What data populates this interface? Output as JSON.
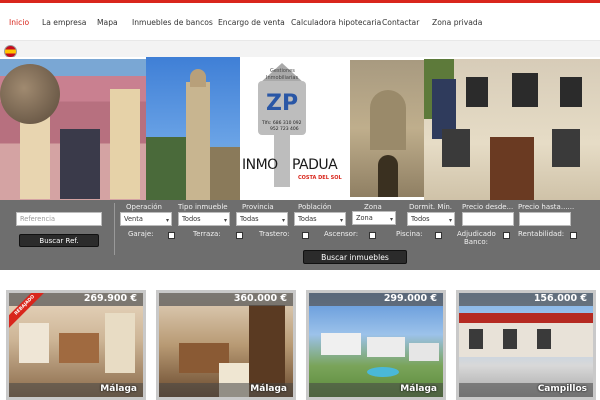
{
  "nav": {
    "items": [
      {
        "label": "Inicio",
        "active": true
      },
      {
        "label": "La empresa",
        "active": false
      },
      {
        "label": "Mapa",
        "active": false
      },
      {
        "label": "Inmuebles de bancos",
        "active": false
      },
      {
        "label": "Encargo de venta",
        "active": false
      },
      {
        "label": "Calculadora hipotecaria",
        "active": false
      },
      {
        "label": "Contactar",
        "active": false
      },
      {
        "label": "Zona privada",
        "active": false
      }
    ]
  },
  "language": {
    "icon": "spain-flag-icon"
  },
  "banner": {
    "logo": {
      "brand_line1": "Gestiones",
      "brand_line2": "Inmobiliarias",
      "initials": "ZP",
      "phone1": "Tlfs: 686 310 092",
      "phone2": "952 723 406",
      "name_left": "INMO",
      "name_right": "PADUA",
      "region": "COSTA DEL SOL"
    }
  },
  "search": {
    "reference_placeholder": "Referencia",
    "reference_button": "Buscar Ref.",
    "fields": [
      {
        "label": "Operación",
        "value": "Venta"
      },
      {
        "label": "Tipo inmueble",
        "value": "Todos"
      },
      {
        "label": "Provincia",
        "value": "Todas"
      },
      {
        "label": "Población",
        "value": "Todas"
      },
      {
        "label": "Zona",
        "value": "Zona"
      },
      {
        "label": "Dormit. Mín.",
        "value": "Todos"
      }
    ],
    "price_from_label": "Precio desde...",
    "price_to_label": "Precio hasta......",
    "checks": [
      {
        "label": "Garaje:"
      },
      {
        "label": "Terraza:"
      },
      {
        "label": "Trastero:"
      },
      {
        "label": "Ascensor:"
      },
      {
        "label": "Piscina:"
      },
      {
        "label_line1": "Adjudicado",
        "label_line2": "Banco:"
      },
      {
        "label": "Rentabilidad:"
      }
    ],
    "submit": "Buscar inmuebles"
  },
  "listings": [
    {
      "price": "269.900 €",
      "city": "Málaga",
      "badge": "REBAJADO"
    },
    {
      "price": "360.000 €",
      "city": "Málaga"
    },
    {
      "price": "299.000 €",
      "city": "Málaga"
    },
    {
      "price": "156.000 €",
      "city": "Campillos"
    }
  ],
  "colors": {
    "accent": "#d9261c",
    "search_bg": "#6e6e6e"
  }
}
